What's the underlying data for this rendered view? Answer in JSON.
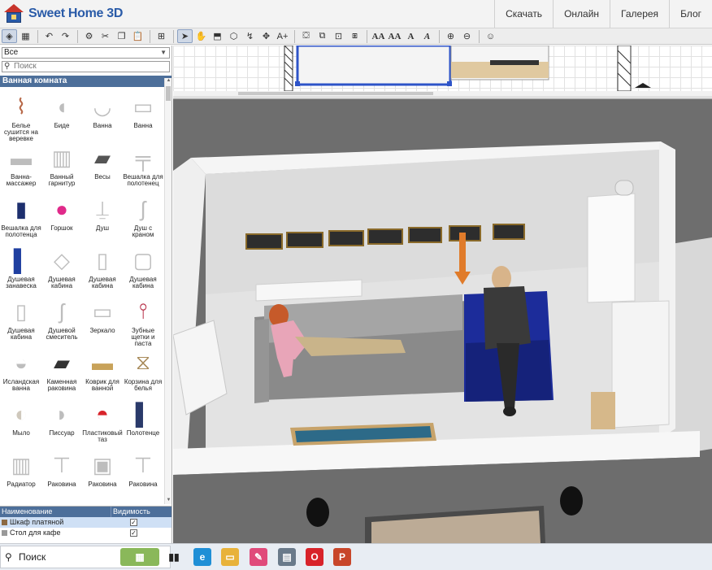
{
  "app": {
    "title": "Sweet Home 3D",
    "nav": [
      "Скачать",
      "Онлайн",
      "Галерея",
      "Блог"
    ]
  },
  "toolbar": {
    "text_buttons": [
      "AA",
      "AA",
      "A",
      "A"
    ]
  },
  "catalog": {
    "selected_category": "Все",
    "search_placeholder": "Поиск",
    "category_title": "Ванная комната",
    "items": [
      {
        "label": "Белье сушится на веревке",
        "icon": "laundry-icon"
      },
      {
        "label": "Биде",
        "icon": "bidet-icon"
      },
      {
        "label": "Ванна",
        "icon": "bathtub-icon"
      },
      {
        "label": "Ванна",
        "icon": "bathtub-square-icon"
      },
      {
        "label": "Ванна-массажер",
        "icon": "jacuzzi-icon"
      },
      {
        "label": "Ванный гарнитур",
        "icon": "bathroom-set-icon"
      },
      {
        "label": "Весы",
        "icon": "scales-icon"
      },
      {
        "label": "Вешалка для полотенец",
        "icon": "towel-rack-icon"
      },
      {
        "label": "Вешалка для полотенца",
        "icon": "towel-hanger-icon"
      },
      {
        "label": "Горшок",
        "icon": "potty-icon"
      },
      {
        "label": "Душ",
        "icon": "shower-icon"
      },
      {
        "label": "Душ с краном",
        "icon": "shower-faucet-icon"
      },
      {
        "label": "Душевая занавеска",
        "icon": "shower-curtain-icon"
      },
      {
        "label": "Душевая кабина",
        "icon": "shower-tray-icon"
      },
      {
        "label": "Душевая кабина",
        "icon": "shower-cabin-icon"
      },
      {
        "label": "Душевая кабина",
        "icon": "shower-cabin-corner-icon"
      },
      {
        "label": "Душевая кабина",
        "icon": "shower-cabin-glass-icon"
      },
      {
        "label": "Душевой смеситель",
        "icon": "shower-mixer-icon"
      },
      {
        "label": "Зеркало",
        "icon": "mirror-icon"
      },
      {
        "label": "Зубные щетки и паста",
        "icon": "toothbrush-icon"
      },
      {
        "label": "Исландская ванна",
        "icon": "icelandic-bath-icon"
      },
      {
        "label": "Каменная раковина",
        "icon": "stone-sink-icon"
      },
      {
        "label": "Коврик для ванной",
        "icon": "bath-mat-icon"
      },
      {
        "label": "Корзина для белья",
        "icon": "laundry-basket-icon"
      },
      {
        "label": "Мыло",
        "icon": "soap-icon"
      },
      {
        "label": "Писсуар",
        "icon": "urinal-icon"
      },
      {
        "label": "Пластиковый таз",
        "icon": "plastic-basin-icon"
      },
      {
        "label": "Полотенце",
        "icon": "towel-icon"
      },
      {
        "label": "Радиатор",
        "icon": "radiator-icon"
      },
      {
        "label": "Раковина",
        "icon": "sink-pedestal-icon"
      },
      {
        "label": "Раковина",
        "icon": "sink-cabinet-icon"
      },
      {
        "label": "Раковина",
        "icon": "sink-column-icon"
      }
    ]
  },
  "furniture_table": {
    "columns": [
      "Наименование",
      "Видимость"
    ],
    "rows": [
      {
        "name": "Шкаф платяной",
        "visible": true,
        "selected": true
      },
      {
        "name": "Стол для кафе",
        "visible": true,
        "selected": false
      }
    ]
  },
  "taskbar": {
    "search_label": "Поиск"
  },
  "colors": {
    "brand": "#2a5ba8",
    "header_bar": "#4d6f9a",
    "accent_orange": "#e07b2a"
  }
}
